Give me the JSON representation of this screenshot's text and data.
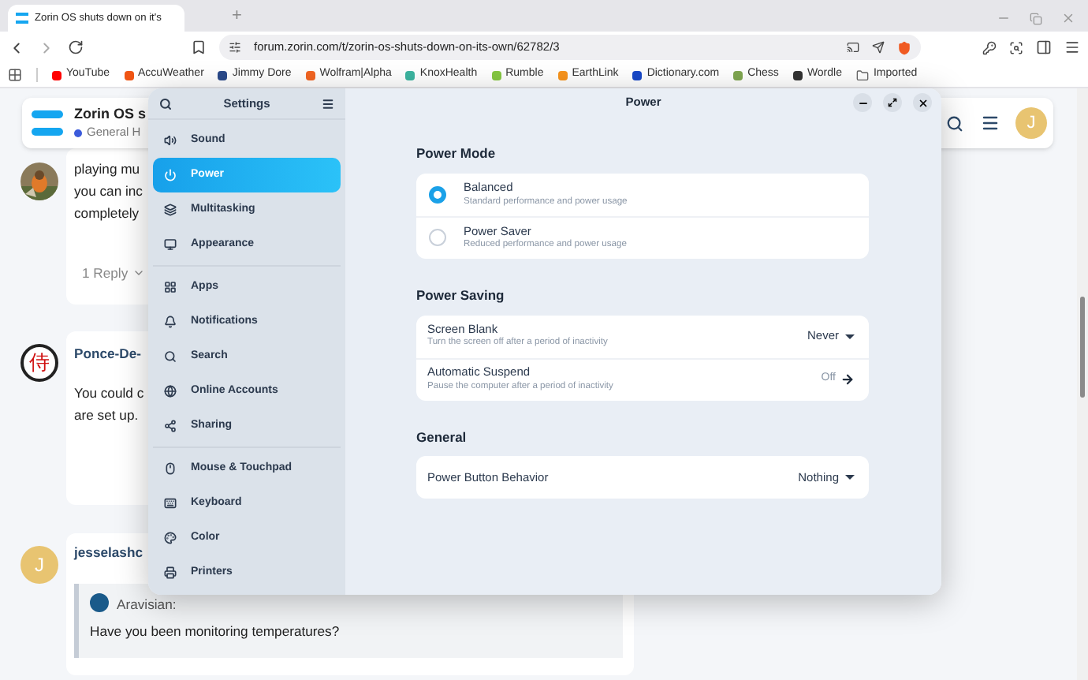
{
  "browser": {
    "tab": {
      "title": "Zorin OS shuts down on it's"
    },
    "new_tab": "+",
    "url": "forum.zorin.com/t/zorin-os-shuts-down-on-its-own/62782/3",
    "bookmarks": [
      {
        "label": "YouTube",
        "color": "#ff0000"
      },
      {
        "label": "AccuWeather",
        "color": "#f05514"
      },
      {
        "label": "Jimmy Dore",
        "color": "#2a4a8a"
      },
      {
        "label": "Wolfram|Alpha",
        "color": "#f26522"
      },
      {
        "label": "KnoxHealth",
        "color": "#3cb4a0"
      },
      {
        "label": "Rumble",
        "color": "#85c742"
      },
      {
        "label": "EarthLink",
        "color": "#f7941d"
      },
      {
        "label": "Dictionary.com",
        "color": "#1848c8"
      },
      {
        "label": "Chess",
        "color": "#7fa650"
      },
      {
        "label": "Wordle",
        "color": "#333333"
      },
      {
        "label": "Imported",
        "color": "#666666"
      }
    ]
  },
  "forum": {
    "site_title": "Zorin OS s",
    "category": "General H",
    "avatar": "J",
    "posts": [
      {
        "lines": [
          "playing mu",
          "you can inc",
          "completely"
        ],
        "replies": "1 Reply"
      },
      {
        "author": "Ponce-De-",
        "avatar": "侍",
        "lines": [
          "You could c",
          "are set up."
        ]
      },
      {
        "author": "jesselashc",
        "avatar": "J",
        "quote": {
          "author": "Aravisian:",
          "text": "Have you been monitoring temperatures?"
        }
      }
    ]
  },
  "settings": {
    "title": "Settings",
    "groups": [
      [
        {
          "label": "Sound",
          "selected": false
        },
        {
          "label": "Power",
          "selected": true
        },
        {
          "label": "Multitasking",
          "selected": false
        },
        {
          "label": "Appearance",
          "selected": false
        }
      ],
      [
        {
          "label": "Apps",
          "selected": false
        },
        {
          "label": "Notifications",
          "selected": false
        },
        {
          "label": "Search",
          "selected": false
        },
        {
          "label": "Online Accounts",
          "selected": false
        },
        {
          "label": "Sharing",
          "selected": false
        }
      ],
      [
        {
          "label": "Mouse & Touchpad",
          "selected": false
        },
        {
          "label": "Keyboard",
          "selected": false
        },
        {
          "label": "Color",
          "selected": false
        },
        {
          "label": "Printers",
          "selected": false
        }
      ]
    ],
    "page": {
      "title": "Power",
      "sections": [
        {
          "title": "Power Mode",
          "rows": [
            {
              "kind": "radio",
              "title": "Balanced",
              "subtitle": "Standard performance and power usage",
              "selected": true
            },
            {
              "kind": "radio",
              "title": "Power Saver",
              "subtitle": "Reduced performance and power usage",
              "selected": false
            }
          ]
        },
        {
          "title": "Power Saving",
          "rows": [
            {
              "kind": "dropdown",
              "title": "Screen Blank",
              "subtitle": "Turn the screen off after a period of inactivity",
              "value": "Never"
            },
            {
              "kind": "link",
              "title": "Automatic Suspend",
              "subtitle": "Pause the computer after a period of inactivity",
              "value": "Off"
            }
          ]
        },
        {
          "title": "General",
          "rows": [
            {
              "kind": "dropdown",
              "title": "Power Button Behavior",
              "value": "Nothing"
            }
          ]
        }
      ]
    }
  }
}
